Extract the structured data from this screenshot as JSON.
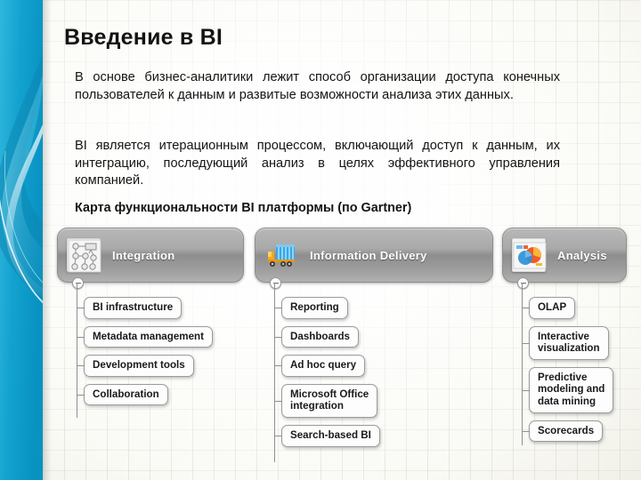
{
  "slide": {
    "title": "Введение в BI",
    "paragraphs": [
      "В основе бизнес-аналитики лежит способ организации доступа конечных пользователей к данным и развитые возможности анализа этих данных.",
      "BI является итерационным процессом, включающий доступ к данным, их интеграцию, последующий анализ в целях эффективного управления компанией."
    ],
    "map_title": "Карта функциональности BI платформы (по Gartner)"
  },
  "colors": {
    "accent_band": "#11a0cd",
    "band_dark": "#0b7fa8",
    "header_box": "#9a9a9a",
    "node_border": "#9b9b9b",
    "text": "#141414"
  },
  "diagram": {
    "columns": [
      {
        "id": "integration",
        "header": {
          "label": "Integration",
          "icon": "flowchart-icon"
        },
        "nodes": [
          "BI infrastructure",
          "Metadata management",
          "Development tools",
          "Collaboration"
        ]
      },
      {
        "id": "information-delivery",
        "header": {
          "label": "Information Delivery",
          "icon": "delivery-truck-icon"
        },
        "nodes": [
          "Reporting",
          "Dashboards",
          "Ad hoc query",
          "Microsoft Office\nintegration",
          "Search-based BI"
        ]
      },
      {
        "id": "analysis",
        "header": {
          "label": "Analysis",
          "icon": "pie-chart-icon"
        },
        "nodes": [
          "OLAP",
          "Interactive\nvisualization",
          "Predictive\nmodeling and\ndata mining",
          "Scorecards"
        ]
      }
    ]
  }
}
